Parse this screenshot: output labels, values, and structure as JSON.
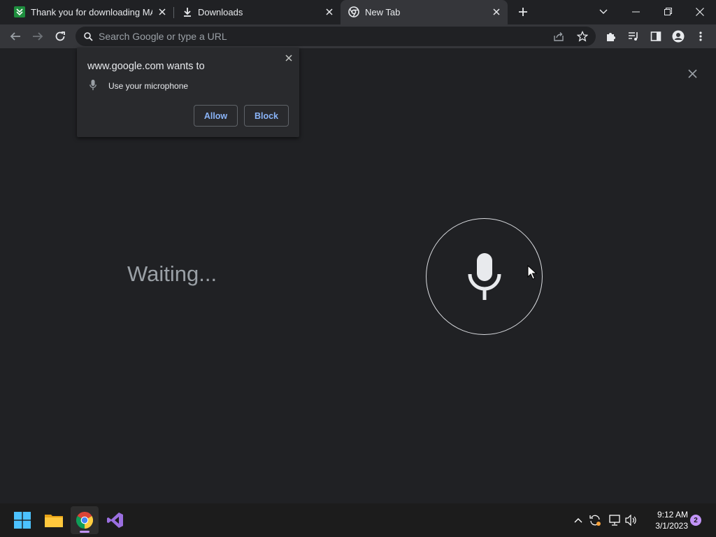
{
  "tabs": [
    {
      "title": "Thank you for downloading MAS",
      "favicon": "green-download-icon"
    },
    {
      "title": "Downloads",
      "favicon": "download-icon"
    },
    {
      "title": "New Tab",
      "favicon": "chrome-icon",
      "active": true
    }
  ],
  "omnibox": {
    "placeholder": "Search Google or type a URL",
    "value": ""
  },
  "permission_popup": {
    "heading": "www.google.com wants to",
    "permission": "Use your microphone",
    "allow_label": "Allow",
    "block_label": "Block"
  },
  "voice_search": {
    "status": "Waiting..."
  },
  "taskbar": {
    "apps": [
      "start",
      "file-explorer",
      "chrome",
      "visual-studio"
    ],
    "clock_time": "9:12 AM",
    "clock_date": "3/1/2023",
    "notification_count": "2"
  },
  "colors": {
    "accent": "#8ab4f8",
    "bg": "#202124",
    "toolbar": "#35363a",
    "taskbar_accent": "#c294f7"
  }
}
